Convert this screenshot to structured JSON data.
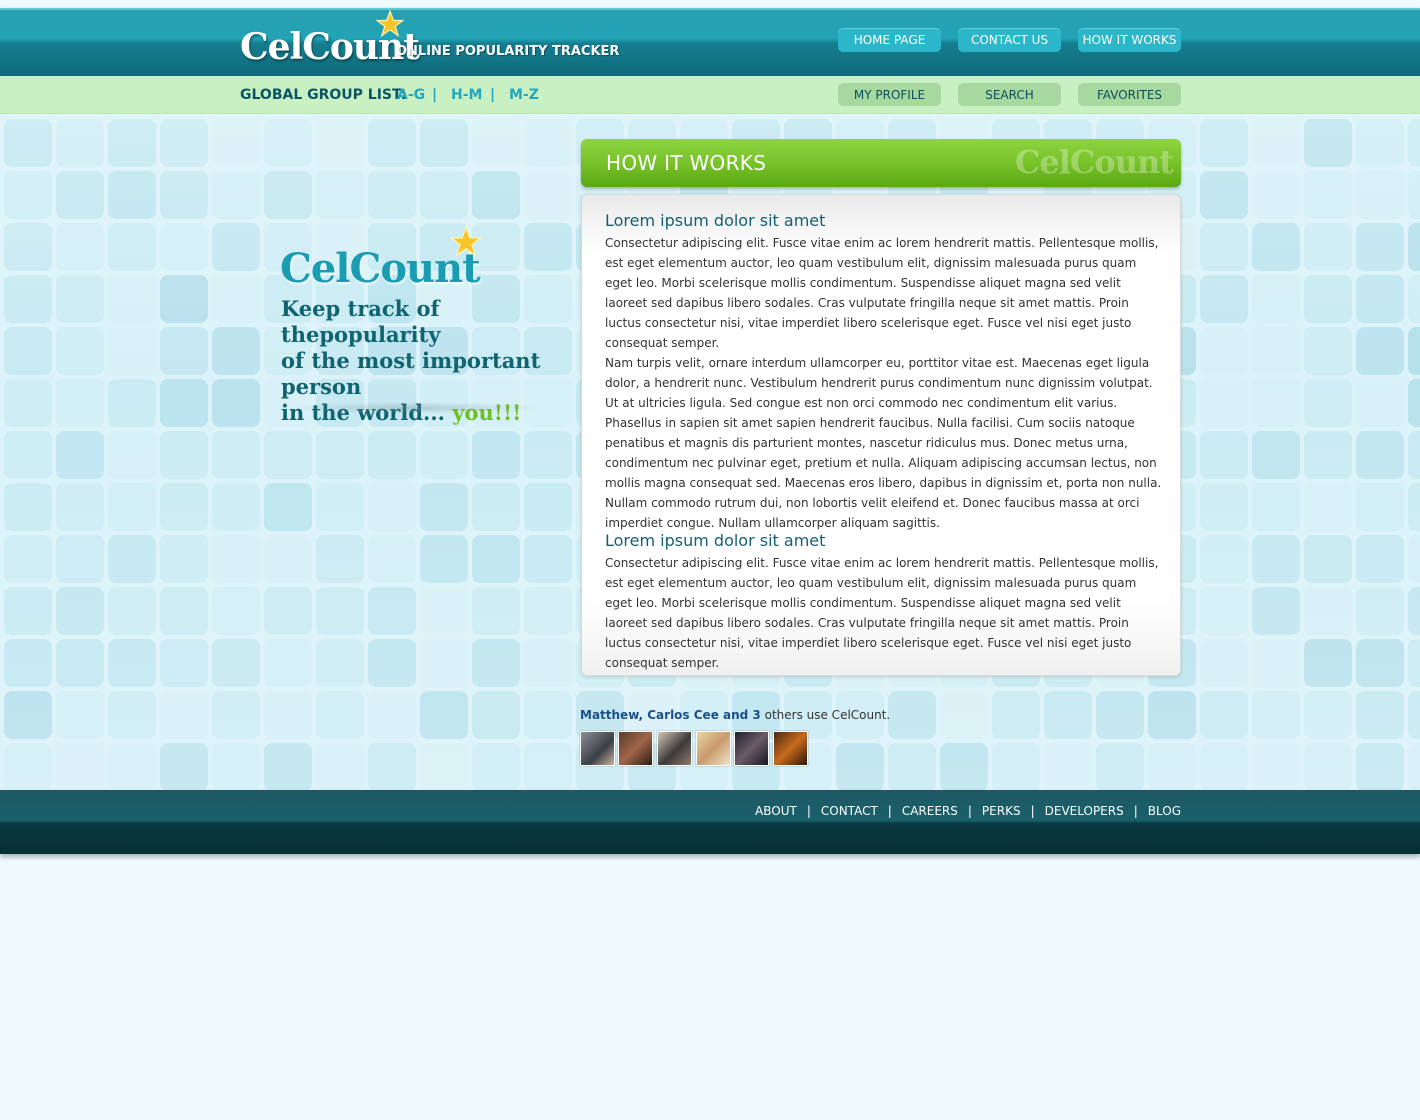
{
  "header": {
    "logo": "CelCount",
    "tagline": "ONLINE POPULARITY TRACKER",
    "nav": [
      {
        "label": "HOME PAGE"
      },
      {
        "label": "CONTACT US"
      },
      {
        "label": "HOW IT WORKS"
      }
    ]
  },
  "subbar": {
    "group_label": "GLOBAL GROUP LIST:",
    "groups": [
      "A-G",
      "H-M",
      "M-Z"
    ],
    "separator": "|",
    "nav": [
      {
        "label": "MY PROFILE"
      },
      {
        "label": "SEARCH"
      },
      {
        "label": "FAVORITES"
      }
    ]
  },
  "hero": {
    "logo": "CelCount",
    "line1": "Keep track of thepopularity",
    "line2": "of the most important person",
    "line3": "in the world...",
    "you": "you!!!"
  },
  "section": {
    "title": "HOW IT WORKS",
    "watermark": "CelCount"
  },
  "content": {
    "heading1": "Lorem ipsum dolor sit amet",
    "para1": "Consectetur adipiscing elit. Fusce vitae enim ac lorem hendrerit mattis. Pellentesque mollis, est eget elementum auctor, leo quam vestibulum elit, dignissim malesuada purus quam eget leo. Morbi scelerisque mollis condimentum. Suspendisse aliquet magna sed velit laoreet sed dapibus libero sodales. Cras vulputate fringilla neque sit amet mattis. Proin luctus consectetur nisi, vitae imperdiet libero scelerisque eget. Fusce vel nisi eget justo consequat semper.",
    "para2": "Nam turpis velit, ornare interdum ullamcorper eu, porttitor vitae est. Maecenas eget ligula dolor, a hendrerit nunc. Vestibulum hendrerit purus condimentum nunc dignissim volutpat. Ut at ultricies ligula. Sed congue est non orci commodo nec condimentum elit varius. Phasellus in sapien sit amet sapien hendrerit faucibus. Nulla facilisi. Cum sociis natoque penatibus et magnis dis parturient montes, nascetur ridiculus mus. Donec metus urna, condimentum nec pulvinar eget, pretium et nulla. Aliquam adipiscing accumsan lectus, non mollis magna consequat sed. Maecenas eros libero, dapibus in dignissim et, porta non nulla. Nullam commodo rutrum dui, non lobortis velit eleifend et. Donec faucibus massa at orci imperdiet congue. Nullam ullamcorper aliquam sagittis.",
    "heading2": "Lorem ipsum dolor sit amet",
    "para3": "Consectetur adipiscing elit. Fusce vitae enim ac lorem hendrerit mattis. Pellentesque mollis, est eget elementum auctor, leo quam vestibulum elit, dignissim malesuada purus quam eget leo. Morbi scelerisque mollis condimentum. Suspendisse aliquet magna sed velit laoreet sed dapibus libero sodales. Cras vulputate fringilla neque sit amet mattis. Proin luctus consectetur nisi, vitae imperdiet libero scelerisque eget. Fusce vel nisi eget justo consequat semper."
  },
  "users": {
    "names": "Matthew, Carlos Cee and 3",
    "suffix": " others use CelCount.",
    "avatars": [
      "avatar-1",
      "avatar-2",
      "avatar-3",
      "avatar-4",
      "avatar-5",
      "avatar-6"
    ]
  },
  "footer": {
    "links": [
      "ABOUT",
      "CONTACT",
      "CAREERS",
      "PERKS",
      "DEVELOPERS",
      "BLOG"
    ],
    "separator": "|"
  },
  "colors": {
    "header": "#1a95a8",
    "accent_green": "#78c22a",
    "subbar": "#c9f0c3",
    "footer": "#0a3941"
  }
}
